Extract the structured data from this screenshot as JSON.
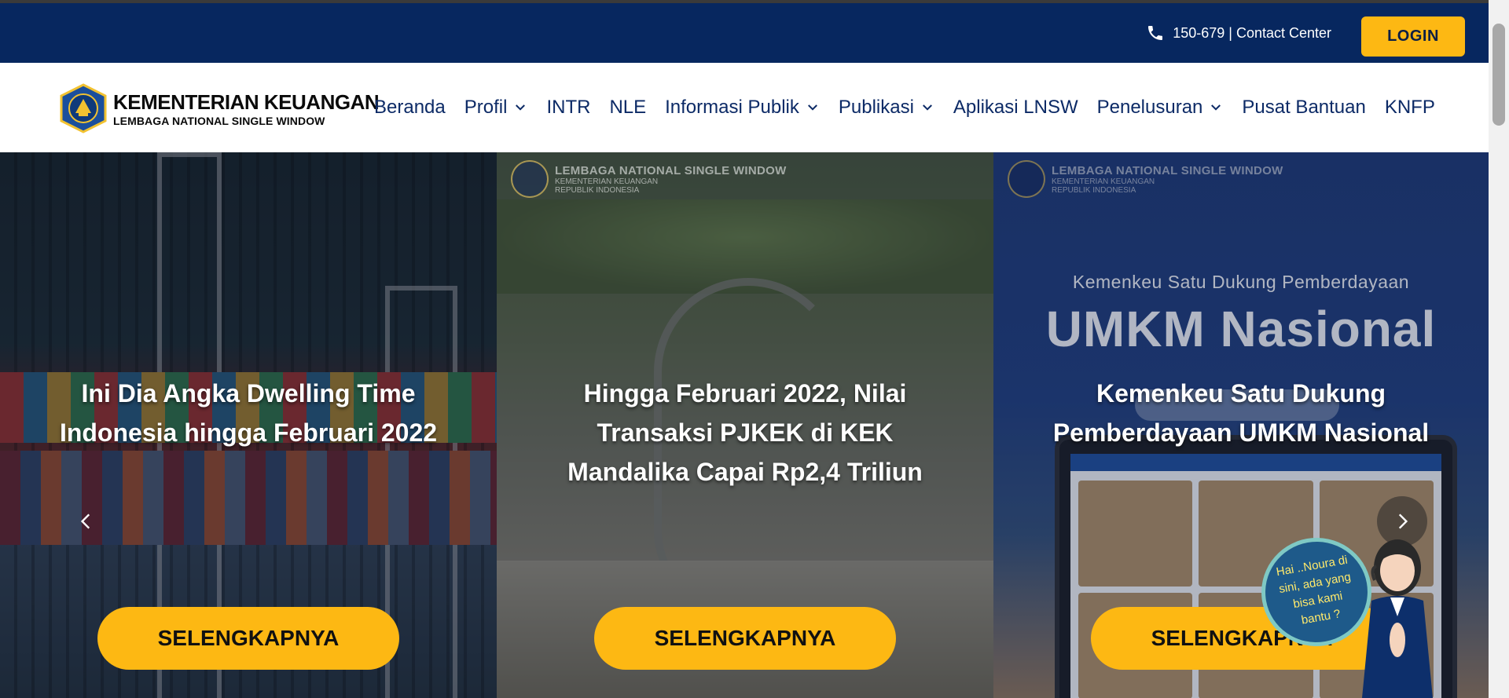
{
  "topbar": {
    "contact_text": "150-679 | Contact Center",
    "login_label": "LOGIN",
    "icons": [
      "phone-icon"
    ]
  },
  "brand": {
    "title": "KEMENTERIAN KEUANGAN",
    "subtitle": "LEMBAGA NATIONAL SINGLE WINDOW"
  },
  "nav": {
    "items": [
      {
        "label": "Beranda",
        "dropdown": false
      },
      {
        "label": "Profil",
        "dropdown": true
      },
      {
        "label": "INTR",
        "dropdown": false
      },
      {
        "label": "NLE",
        "dropdown": false
      },
      {
        "label": "Informasi Publik",
        "dropdown": true
      },
      {
        "label": "Publikasi",
        "dropdown": true
      },
      {
        "label": "Aplikasi LNSW",
        "dropdown": false
      },
      {
        "label": "Penelusuran",
        "dropdown": true
      },
      {
        "label": "Pusat Bantuan",
        "dropdown": false
      },
      {
        "label": "KNFP",
        "dropdown": false
      }
    ]
  },
  "slides": [
    {
      "caption": "Ini Dia Angka Dwelling Time Indonesia hingga Februari 2022",
      "button": "SELENGKAPNYA"
    },
    {
      "caption": "Hingga Februari 2022, Nilai Transaksi PJKEK di KEK Mandalika Capai Rp2,4 Triliun",
      "button": "SELENGKAPNYA"
    },
    {
      "caption": "Kemenkeu Satu Dukung Pemberdayaan UMKM Nasional",
      "button": "SELENGKAPNYA"
    }
  ],
  "slide_watermark": {
    "line1": "LEMBAGA NATIONAL SINGLE WINDOW",
    "line2": "KEMENTERIAN KEUANGAN",
    "line3": "REPUBLIK INDONESIA"
  },
  "promo": {
    "subtitle": "Kemenkeu Satu Dukung Pemberdayaan",
    "headline": "UMKM Nasional"
  },
  "chatbot": {
    "greeting": "Hai ..Noura di sini, ada yang bisa kami bantu ?"
  },
  "colors": {
    "topbar_bg": "#07275f",
    "accent": "#fdb813",
    "nav_text": "#0c2a66"
  }
}
